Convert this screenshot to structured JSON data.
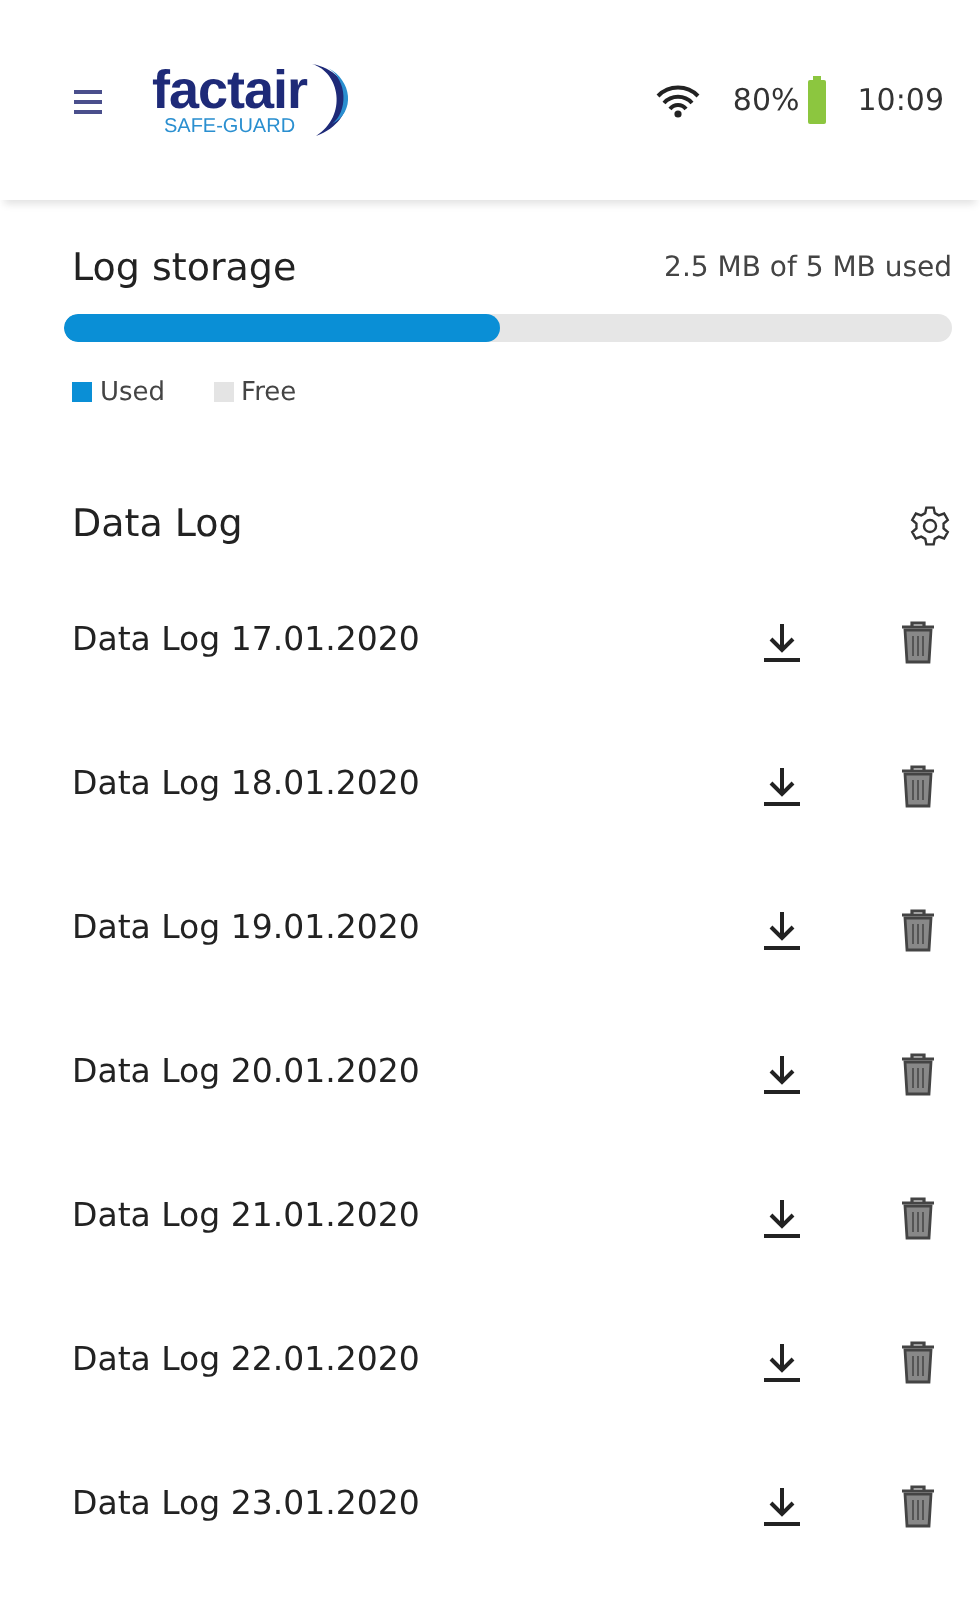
{
  "header": {
    "logo": {
      "name": "factair",
      "tagline": "SAFE-GUARD"
    },
    "battery": "80%",
    "time": "10:09"
  },
  "storage": {
    "title": "Log storage",
    "reading": "2.5 MB of 5 MB used",
    "level": 0.49,
    "legend": [
      {
        "label": "Used",
        "color": "#0a8fd6"
      },
      {
        "label": "Free",
        "color": "#e4e4e4"
      }
    ]
  },
  "data_log": {
    "title": "Data Log",
    "entries": [
      {
        "name": "Data Log 17.01.2020"
      },
      {
        "name": "Data Log 18.01.2020"
      },
      {
        "name": "Data Log 19.01.2020"
      },
      {
        "name": "Data Log 20.01.2020"
      },
      {
        "name": "Data Log 21.01.2020"
      },
      {
        "name": "Data Log 22.01.2020"
      },
      {
        "name": "Data Log 23.01.2020"
      }
    ]
  }
}
